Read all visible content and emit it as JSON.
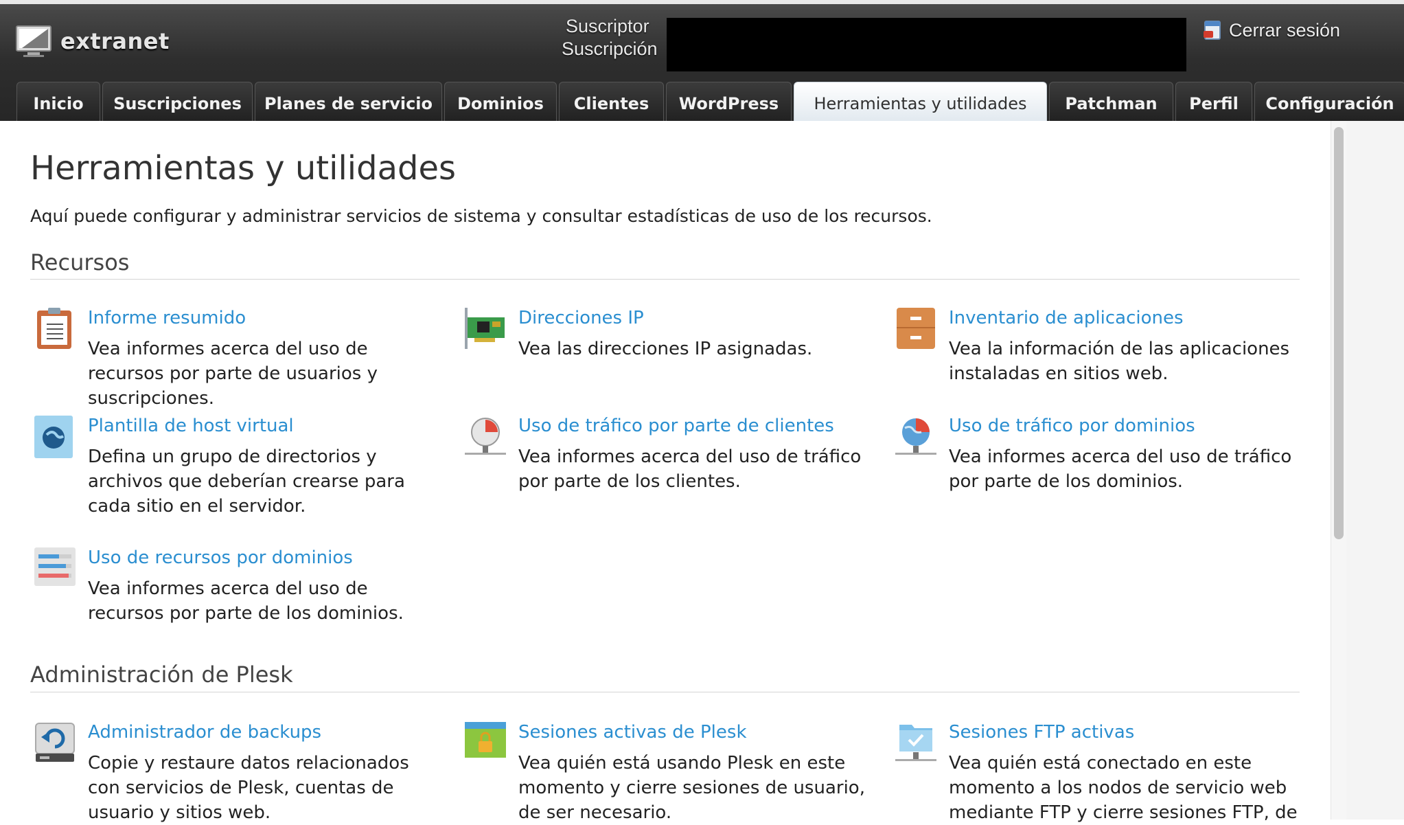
{
  "header": {
    "logo_text": "extranet",
    "subscriber_label": "Suscriptor",
    "subscription_label": "Suscripción",
    "logout_label": "Cerrar sesión"
  },
  "tabs": [
    {
      "label": "Inicio"
    },
    {
      "label": "Suscripciones"
    },
    {
      "label": "Planes de servicio"
    },
    {
      "label": "Dominios"
    },
    {
      "label": "Clientes"
    },
    {
      "label": "WordPress"
    },
    {
      "label": "Herramientas y utilidades",
      "active": true
    },
    {
      "label": "Patchman"
    },
    {
      "label": "Perfil"
    },
    {
      "label": "Configuración"
    }
  ],
  "page": {
    "title": "Herramientas y utilidades",
    "description": "Aquí puede configurar y administrar servicios de sistema y consultar estadísticas de uso de los recursos."
  },
  "sections": [
    {
      "title": "Recursos",
      "tools": [
        {
          "name": "Informe resumido",
          "desc": "Vea informes acerca del uso de recursos por parte de usuarios y suscripciones.",
          "icon": "clipboard-report-icon"
        },
        {
          "name": "Direcciones IP",
          "desc": "Vea las direcciones IP asignadas.",
          "icon": "network-card-icon"
        },
        {
          "name": "Inventario de aplicaciones",
          "desc": "Vea la información de las aplicaciones instaladas en sitios web.",
          "icon": "cabinet-icon"
        },
        {
          "name": "Plantilla de host virtual",
          "desc": "Defina un grupo de directorios y archivos que deberían crearse para cada sitio en el servidor.",
          "icon": "globe-template-icon"
        },
        {
          "name": "Uso de tráfico por parte de clientes",
          "desc": "Vea informes acerca del uso de tráfico por parte de los clientes.",
          "icon": "pie-chart-network-icon"
        },
        {
          "name": "Uso de tráfico por dominios",
          "desc": "Vea informes acerca del uso de tráfico por parte de los dominios.",
          "icon": "globe-chart-network-icon"
        },
        {
          "name": "Uso de recursos por dominios",
          "desc": "Vea informes acerca del uso de recursos por parte de los dominios.",
          "icon": "bars-usage-icon"
        }
      ]
    },
    {
      "title": "Administración de Plesk",
      "tools": [
        {
          "name": "Administrador de backups",
          "desc": "Copie y restaure datos relacionados con servicios de Plesk, cuentas de usuario y sitios web.",
          "icon": "backup-drive-icon"
        },
        {
          "name": "Sesiones activas de Plesk",
          "desc": "Vea quién está usando Plesk en este momento y cierre sesiones de usuario, de ser necesario.",
          "icon": "lock-window-icon"
        },
        {
          "name": "Sesiones FTP activas",
          "desc": "Vea quién está conectado en este momento a los nodos de servicio web mediante FTP y cierre sesiones FTP, de",
          "icon": "ftp-folder-icon"
        }
      ]
    }
  ],
  "colors": {
    "link": "#2a8ed0",
    "header_bg": "#2e2e2e",
    "active_tab_bg": "#dfe7ee"
  }
}
